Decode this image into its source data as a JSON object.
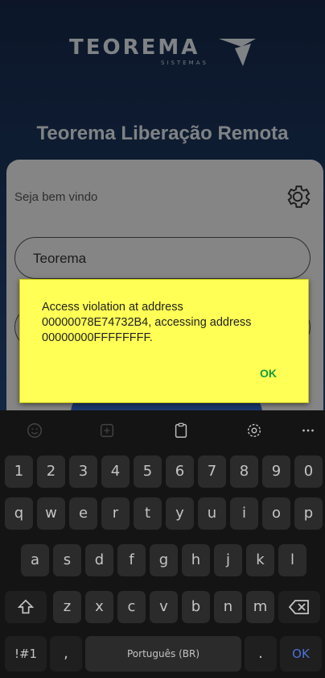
{
  "logo": {
    "name": "TEOREMA",
    "tagline": "SISTEMAS"
  },
  "app_title": "Teorema Liberação Remota",
  "login_card": {
    "welcome": "Seja bem vindo",
    "username_value": "Teorema"
  },
  "dialog": {
    "message": "Access violation at address 00000078E74732B4, accessing address 00000000FFFFFFFF.",
    "ok_label": "OK",
    "background": "#ffff55",
    "ok_color": "#199a3e"
  },
  "keyboard": {
    "toolbar": [
      "emoji-icon",
      "sticker-icon",
      "clipboard-icon",
      "settings-icon",
      "more-icon"
    ],
    "numbers": [
      "1",
      "2",
      "3",
      "4",
      "5",
      "6",
      "7",
      "8",
      "9",
      "0"
    ],
    "row1": [
      "q",
      "w",
      "e",
      "r",
      "t",
      "y",
      "u",
      "i",
      "o",
      "p"
    ],
    "row2": [
      "a",
      "s",
      "d",
      "f",
      "g",
      "h",
      "j",
      "k",
      "l"
    ],
    "row3": [
      "z",
      "x",
      "c",
      "v",
      "b",
      "n",
      "m"
    ],
    "symbols_label": "!#1",
    "comma_label": ",",
    "space_label": "Português (BR)",
    "period_label": ".",
    "enter_label": "OK",
    "enter_color": "#4a73d8"
  }
}
